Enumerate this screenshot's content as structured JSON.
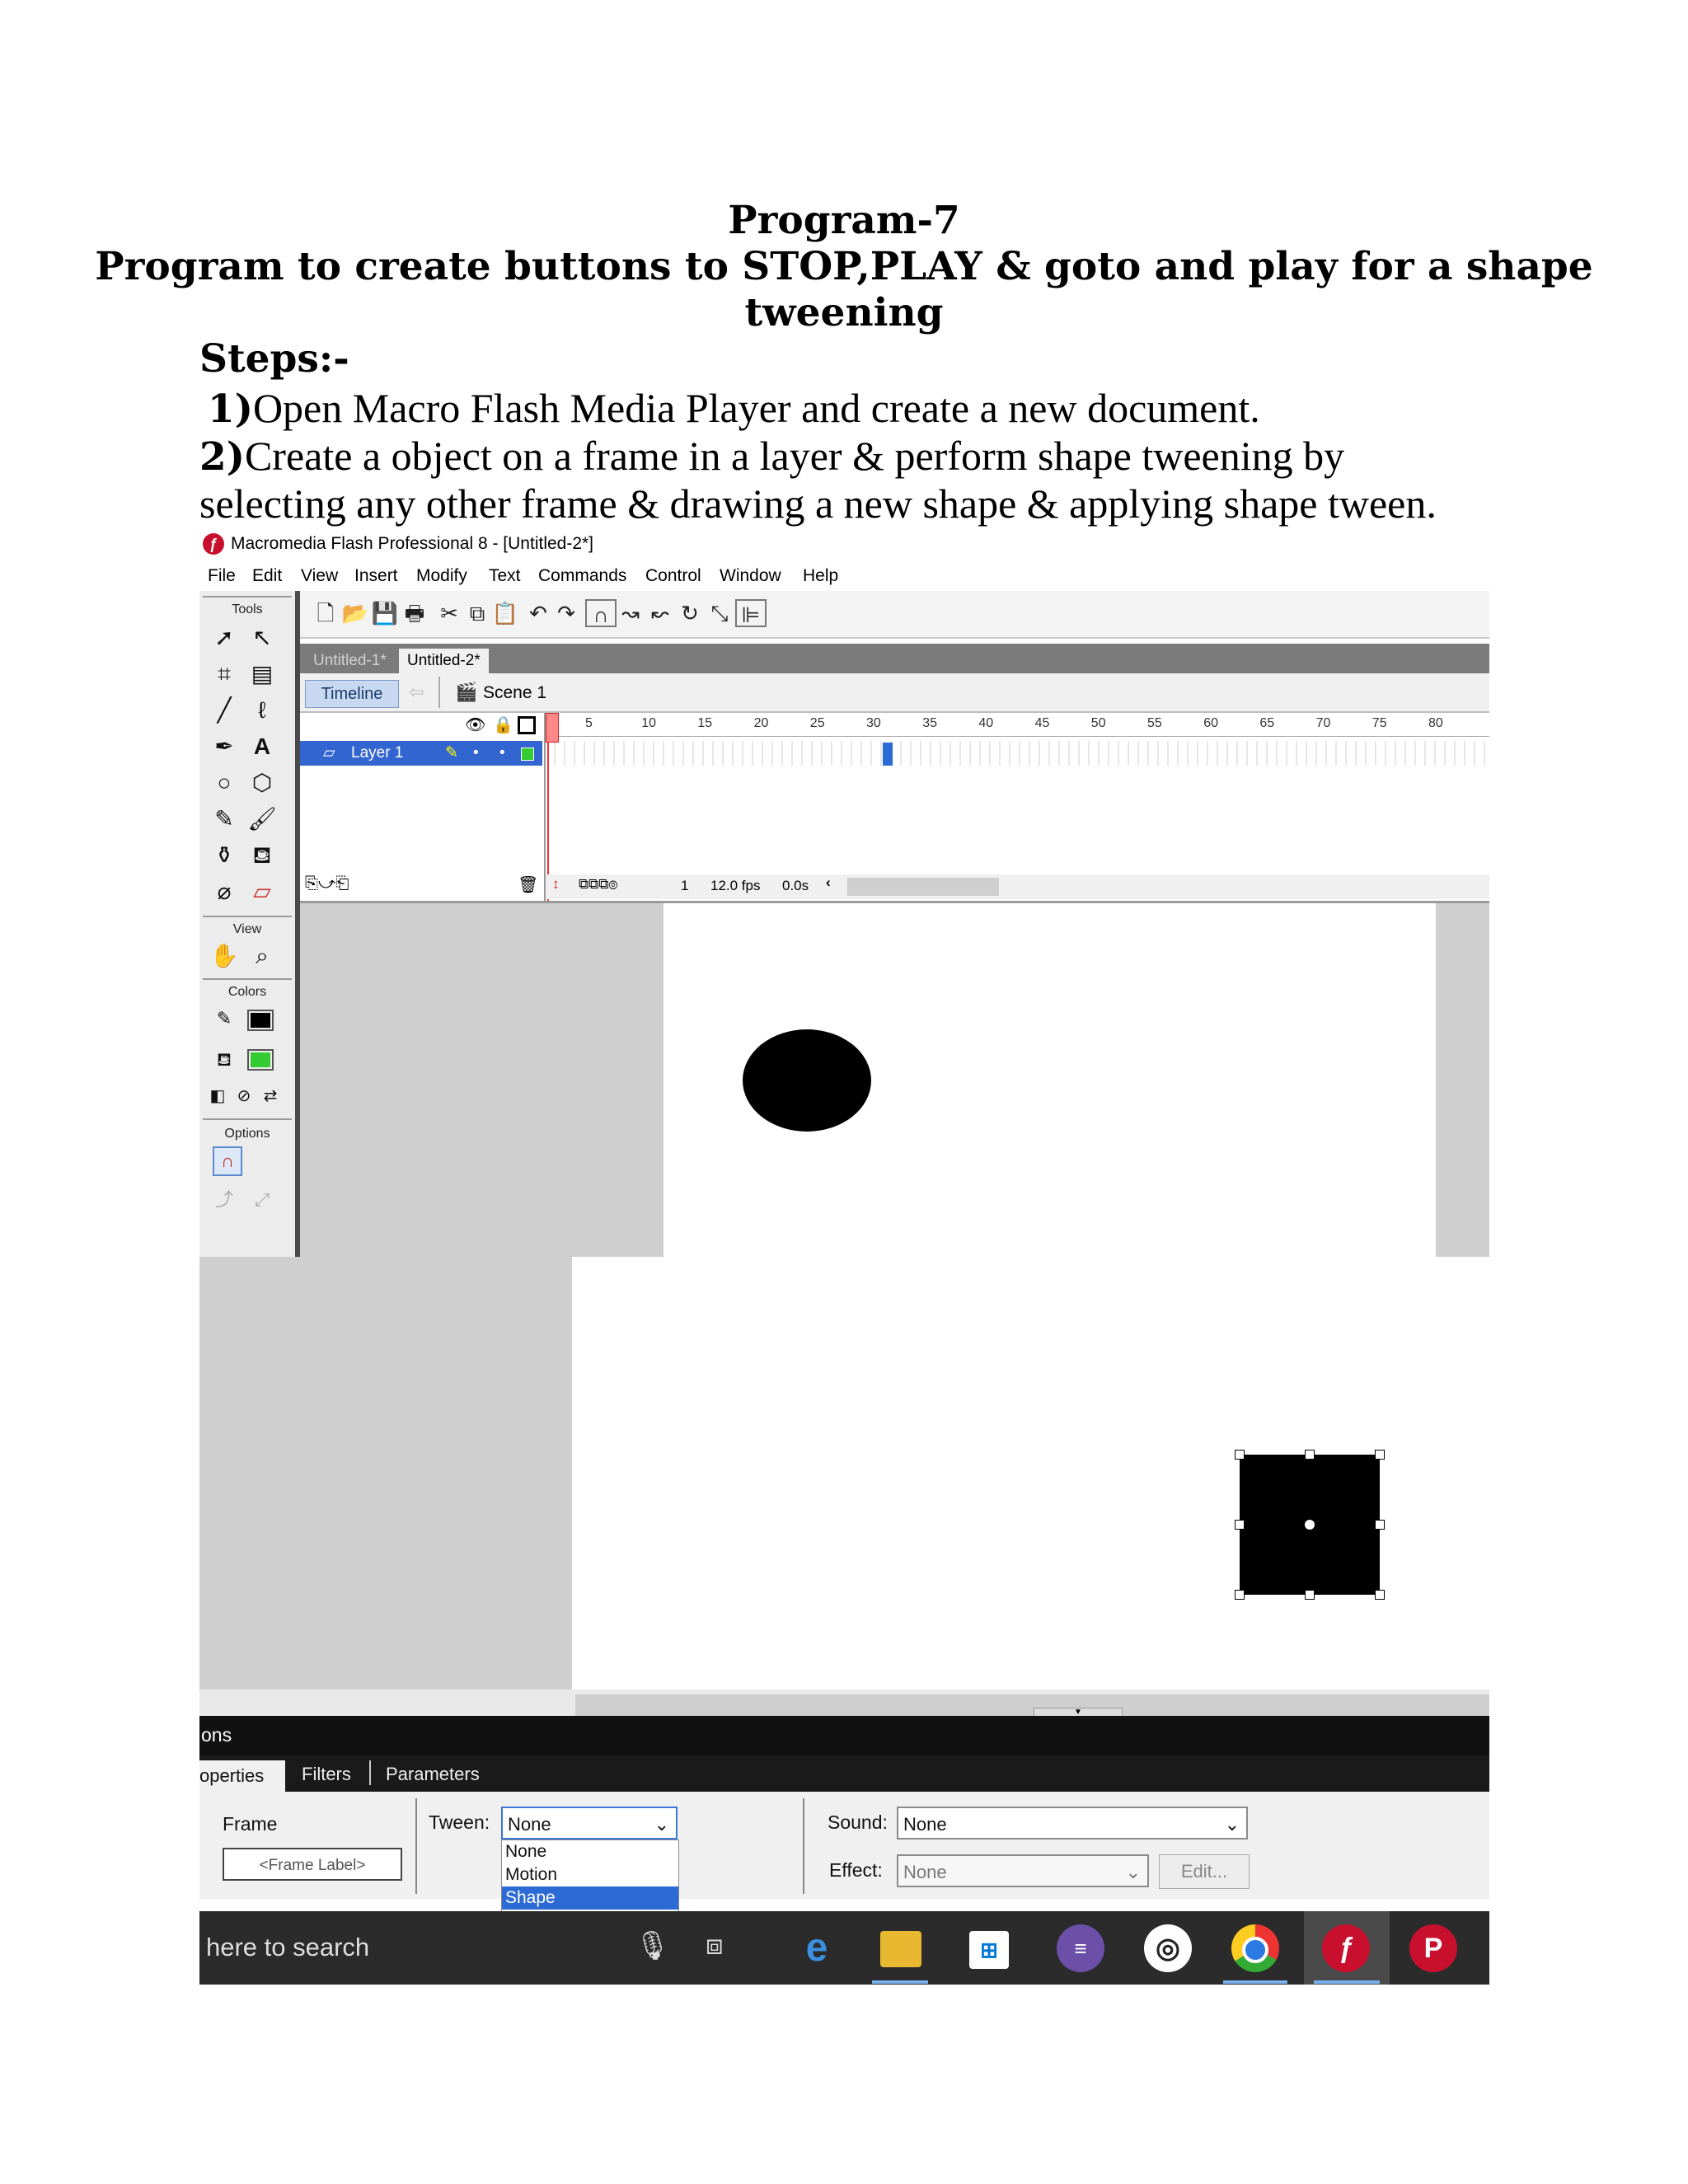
{
  "document": {
    "title_line1": "Program-7",
    "title_line2": "Program to create buttons to STOP,PLAY & goto and play for a shape",
    "title_line3": "tweening",
    "steps_heading": "Steps:-",
    "step1_num": "1)",
    "step1_text": "Open  Macro Flash Media Player and create a new document.",
    "step2_num": "2)",
    "step2_text_a": "Create a object on a frame in a layer & perform shape tweening by",
    "step2_text_b": "selecting any other frame & drawing a new shape & applying shape tween."
  },
  "app": {
    "window_title": "Macromedia Flash Professional 8 - [Untitled-2*]",
    "menu": [
      "File",
      "Edit",
      "View",
      "Insert",
      "Modify",
      "Text",
      "Commands",
      "Control",
      "Window",
      "Help"
    ],
    "tools_label": "Tools",
    "view_label": "View",
    "colors_label": "Colors",
    "options_label": "Options",
    "doc_tabs": [
      "Untitled-1*",
      "Untitled-2*"
    ],
    "timeline_button": "Timeline",
    "scene_label": "Scene 1",
    "frame_numbers": [
      "5",
      "10",
      "15",
      "20",
      "25",
      "30",
      "35",
      "40",
      "45",
      "50",
      "55",
      "60",
      "65",
      "70",
      "75",
      "80"
    ],
    "layer_name": "Layer 1",
    "current_frame": "1",
    "fps": "12.0 fps",
    "elapsed": "0.0s",
    "stroke_color": "#000000",
    "fill_color": "#33cc33",
    "panel_title": "ons",
    "props_tabs": [
      "operties",
      "Filters",
      "Parameters"
    ],
    "frame_label": "Frame",
    "frame_label_placeholder": "<Frame Label>",
    "tween_label": "Tween:",
    "tween_value": "None",
    "tween_options": [
      "None",
      "Motion",
      "Shape"
    ],
    "sound_label": "Sound:",
    "sound_value": "None",
    "effect_label": "Effect:",
    "effect_value": "None",
    "edit_button": "Edit...",
    "taskbar_search": "here to search"
  }
}
